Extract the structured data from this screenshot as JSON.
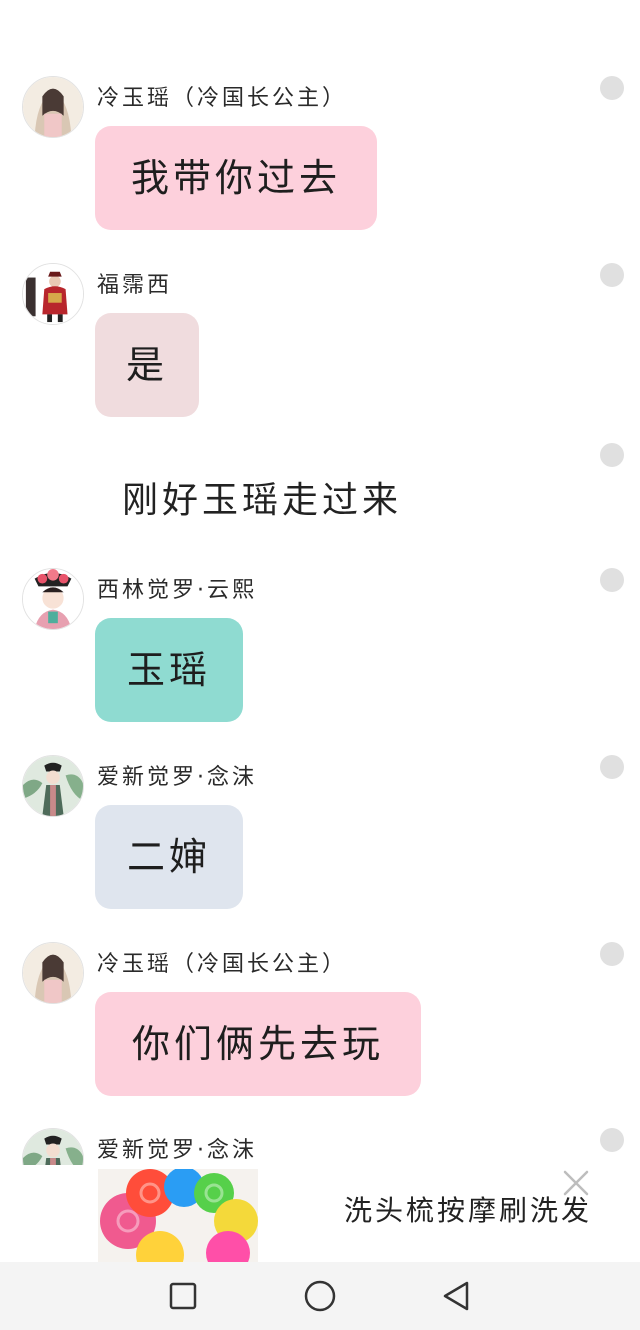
{
  "messages": [
    {
      "sender": "冷玉瑶（冷国长公主）",
      "text": "我带你过去",
      "bubble_color": "#fdd0dc"
    },
    {
      "sender": "福霈西",
      "text": "是",
      "bubble_color": "#f0dcde"
    },
    {
      "narration": "刚好玉瑶走过来"
    },
    {
      "sender": "西林觉罗·云熙",
      "text": "玉瑶",
      "bubble_color": "#8fdbd1"
    },
    {
      "sender": "爱新觉罗·念沫",
      "text": "二婶",
      "bubble_color": "#dfe5ee"
    },
    {
      "sender": "冷玉瑶（冷国长公主）",
      "text": "你们俩先去玩",
      "bubble_color": "#fdd0dc"
    },
    {
      "sender": "爱新觉罗·念沫"
    }
  ],
  "ad": {
    "title": "洗头梳按摩刷洗发",
    "image": "colorful-silicone-shampoo-brushes",
    "close_icon": "close-icon"
  },
  "navbar": {
    "recents_icon": "square-recents-icon",
    "home_icon": "circle-home-icon",
    "back_icon": "triangle-back-icon"
  }
}
